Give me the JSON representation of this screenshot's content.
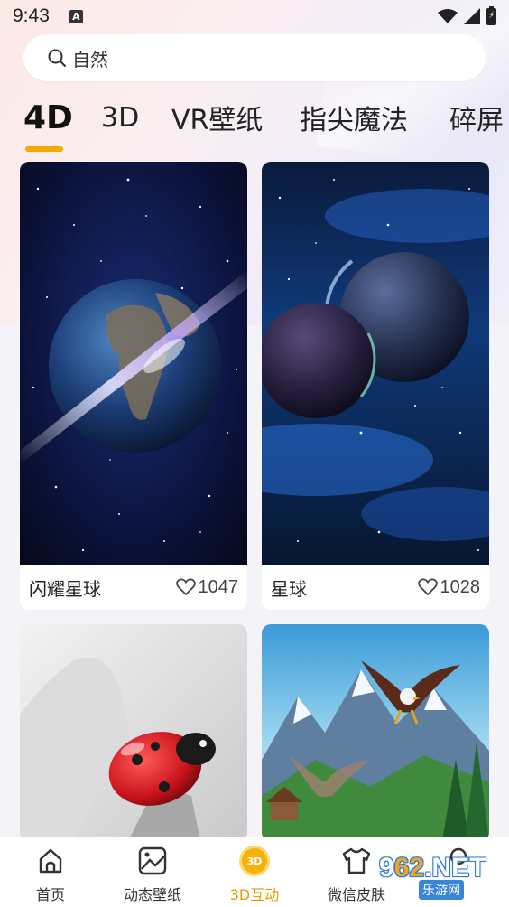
{
  "status_bar": {
    "time": "9:43",
    "notification_letter": "A"
  },
  "search": {
    "text": "自然"
  },
  "tabs": [
    {
      "label": "4D",
      "active": true
    },
    {
      "label": "3D"
    },
    {
      "label": "VR壁纸"
    },
    {
      "label": "指尖魔法"
    },
    {
      "label": "碎屏"
    }
  ],
  "cards": [
    {
      "title": "闪耀星球",
      "likes": "1047"
    },
    {
      "title": "星球",
      "likes": "1028"
    },
    {
      "title": "",
      "likes": ""
    },
    {
      "title": "",
      "likes": ""
    }
  ],
  "bottom_nav": [
    {
      "label": "首页",
      "icon": "home-icon"
    },
    {
      "label": "动态壁纸",
      "icon": "image-icon"
    },
    {
      "label": "3D互动",
      "icon": "3d-icon",
      "active": true
    },
    {
      "label": "微信皮肤",
      "icon": "shirt-icon"
    },
    {
      "label": "",
      "icon": "profile-icon"
    }
  ],
  "watermark": {
    "brand_prefix": "9",
    "brand_num": "62",
    "brand_suffix": ".NET",
    "subtitle": "乐游网"
  },
  "colors": {
    "accent": "#f5a900",
    "active_nav": "#e79c00"
  }
}
